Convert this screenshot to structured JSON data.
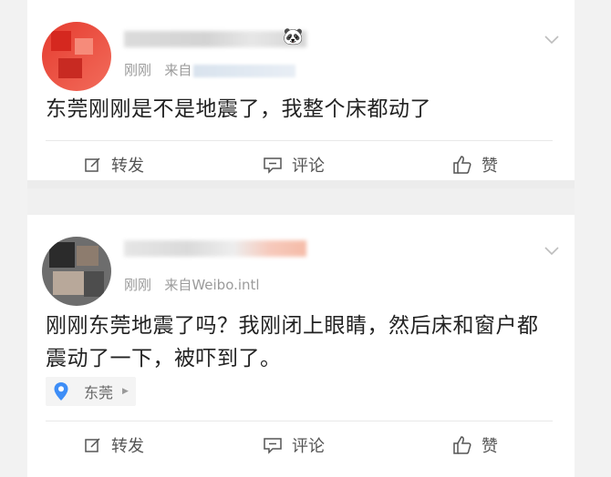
{
  "posts": [
    {
      "meta": {
        "time": "刚刚",
        "source_prefix": "来自"
      },
      "text": "东莞刚刚是不是地震了，我整个床都动了",
      "actions": {
        "repost": "转发",
        "comment": "评论",
        "like": "赞"
      }
    },
    {
      "meta": {
        "time": "刚刚",
        "source_prefix": "来自Weibo.intl"
      },
      "text": "刚刚东莞地震了吗？我刚闭上眼睛，然后床和窗户都震动了一下，被吓到了。",
      "location": "东莞",
      "actions": {
        "repost": "转发",
        "comment": "评论",
        "like": "赞"
      }
    }
  ],
  "icons": {
    "repost": "edit-square-icon",
    "comment": "comment-bubble-icon",
    "like": "thumbs-up-icon",
    "more": "chevron-down-icon",
    "location": "location-pin-icon",
    "panda": "panda-emoji-icon"
  },
  "colors": {
    "background": "#f2f2f2",
    "card": "#ffffff",
    "text": "#222222",
    "meta": "#9b9b9b",
    "location_pin": "#3e8ef7"
  }
}
